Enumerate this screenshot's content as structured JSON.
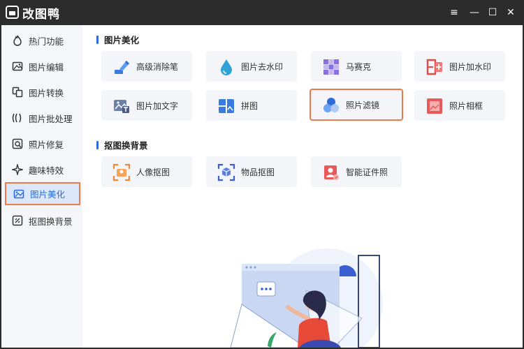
{
  "app": {
    "title": "改图鸭"
  },
  "window": {
    "menu_icon": "≡",
    "minimize_icon": "—",
    "maximize_icon": "☐",
    "close_icon": "✕"
  },
  "sidebar": {
    "items": [
      {
        "label": "热门功能",
        "icon": "flame-icon"
      },
      {
        "label": "图片编辑",
        "icon": "image-edit-icon"
      },
      {
        "label": "图片转换",
        "icon": "convert-icon"
      },
      {
        "label": "图片批处理",
        "icon": "batch-icon"
      },
      {
        "label": "照片修复",
        "icon": "photo-repair-icon"
      },
      {
        "label": "趣味特效",
        "icon": "sparkle-icon"
      },
      {
        "label": "图片美化",
        "icon": "beautify-icon",
        "active": true
      },
      {
        "label": "抠图换背景",
        "icon": "cutout-icon"
      }
    ]
  },
  "sections": [
    {
      "title": "图片美化",
      "cards": [
        {
          "label": "高级消除笔",
          "icon": "eraser-pen-icon"
        },
        {
          "label": "图片去水印",
          "icon": "water-drop-icon"
        },
        {
          "label": "马赛克",
          "icon": "mosaic-icon"
        },
        {
          "label": "图片加水印",
          "icon": "add-watermark-icon"
        },
        {
          "label": "图片加文字",
          "icon": "add-text-icon"
        },
        {
          "label": "拼图",
          "icon": "collage-icon"
        },
        {
          "label": "照片滤镜",
          "icon": "filter-icon",
          "highlighted": true
        },
        {
          "label": "照片相框",
          "icon": "photo-frame-icon"
        }
      ]
    },
    {
      "title": "抠图换背景",
      "cards": [
        {
          "label": "人像抠图",
          "icon": "portrait-cutout-icon"
        },
        {
          "label": "物品抠图",
          "icon": "object-cutout-icon"
        },
        {
          "label": "智能证件照",
          "icon": "id-photo-icon"
        }
      ]
    }
  ],
  "colors": {
    "accent": "#2f6bd8",
    "highlight_border": "#ee7a4a",
    "sidebar_bg": "#f4f6f9",
    "card_bg": "#f3f5f8",
    "titlebar": "#2c2c2c"
  }
}
